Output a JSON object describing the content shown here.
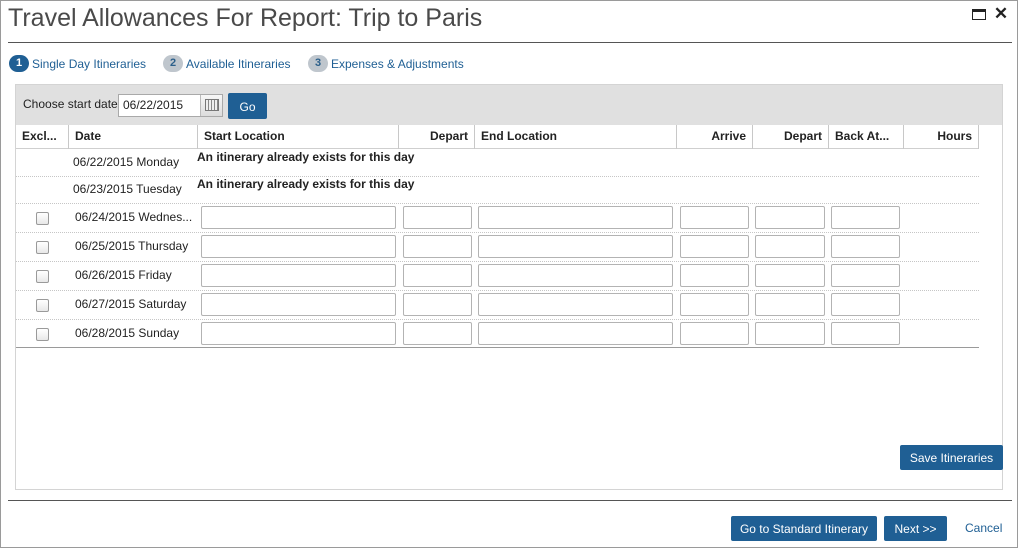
{
  "dialog": {
    "title": "Travel Allowances For Report: Trip to Paris"
  },
  "steps": [
    {
      "num": "1",
      "label": "Single Day Itineraries",
      "active": true
    },
    {
      "num": "2",
      "label": "Available Itineraries",
      "active": false
    },
    {
      "num": "3",
      "label": "Expenses & Adjustments",
      "active": false
    }
  ],
  "start_date": {
    "label": "Choose start date",
    "value": "06/22/2015",
    "go_label": "Go"
  },
  "columns": [
    "Excl...",
    "Date",
    "Start Location",
    "Depart",
    "End Location",
    "Arrive",
    "Depart",
    "Back At...",
    "Hours"
  ],
  "rows": [
    {
      "date": "06/22/2015 Monday",
      "message": "An itinerary already exists for this day"
    },
    {
      "date": "06/23/2015 Tuesday",
      "message": "An itinerary already exists for this day"
    },
    {
      "date": "06/24/2015 Wednes..."
    },
    {
      "date": "06/25/2015 Thursday"
    },
    {
      "date": "06/26/2015 Friday"
    },
    {
      "date": "06/27/2015 Saturday"
    },
    {
      "date": "06/28/2015 Sunday"
    }
  ],
  "buttons": {
    "save": "Save Itineraries",
    "standard": "Go to Standard Itinerary",
    "next": "Next >>",
    "cancel": "Cancel"
  }
}
